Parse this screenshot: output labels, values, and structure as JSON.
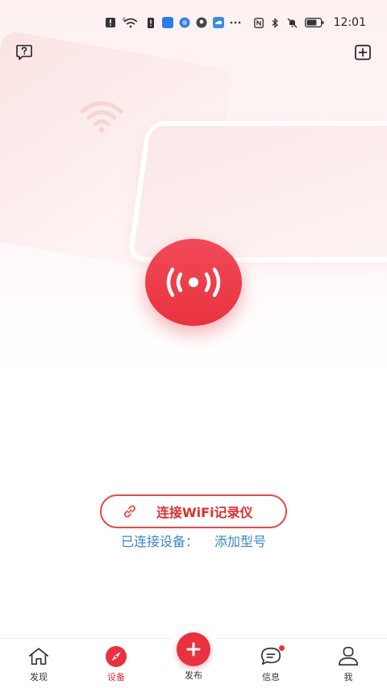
{
  "status_bar": {
    "time": "12:01",
    "signal_superscript": "6"
  },
  "main": {
    "connect_button_label": "连接WiFi记录仪",
    "connected_prefix": "已连接设备：",
    "add_model_link": "添加型号"
  },
  "tabs": [
    {
      "label": "发现",
      "icon": "home-icon"
    },
    {
      "label": "设备",
      "icon": "compass-icon"
    },
    {
      "label": "发布",
      "icon": "plus-icon"
    },
    {
      "label": "信息",
      "icon": "chat-icon"
    },
    {
      "label": "我",
      "icon": "user-icon"
    }
  ],
  "colors": {
    "accent": "#e9323f",
    "link_blue": "#3c86c9",
    "tab_text": "#333333"
  }
}
